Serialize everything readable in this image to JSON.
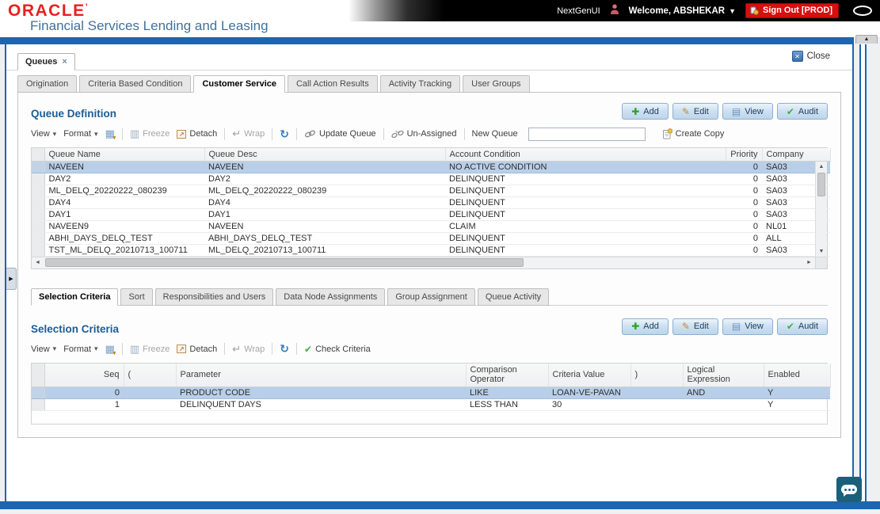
{
  "header": {
    "logo": "ORACLE",
    "logo_mark": "’",
    "subtitle": "Financial Services Lending and Leasing",
    "nextgen_label": "NextGenUI",
    "welcome": "Welcome, ABSHEKAR",
    "sign_out": "Sign Out [PROD]"
  },
  "workspace": {
    "tab_label": "Queues",
    "tab_close": "×",
    "close_label": "Close"
  },
  "main_tabs": {
    "items": [
      "Origination",
      "Criteria Based Condition",
      "Customer Service",
      "Call Action Results",
      "Activity Tracking",
      "User Groups"
    ],
    "active": "Customer Service"
  },
  "actions": {
    "add": "Add",
    "edit": "Edit",
    "view": "View",
    "audit": "Audit"
  },
  "queue_definition": {
    "heading": "Queue Definition",
    "toolbar": {
      "view": "View",
      "format": "Format",
      "freeze": "Freeze",
      "detach": "Detach",
      "wrap": "Wrap",
      "update_queue": "Update Queue",
      "un_assigned": "Un-Assigned",
      "new_queue_label": "New Queue",
      "new_queue_value": "",
      "create_copy": "Create Copy"
    },
    "columns": [
      "Queue Name",
      "Queue Desc",
      "Account Condition",
      "Priority",
      "Company"
    ],
    "rows": [
      {
        "name": "NAVEEN",
        "desc": "NAVEEN",
        "condition": "NO ACTIVE CONDITION",
        "priority": "0",
        "company": "SA03",
        "selected": true
      },
      {
        "name": "DAY2",
        "desc": "DAY2",
        "condition": "DELINQUENT",
        "priority": "0",
        "company": "SA03",
        "selected": false
      },
      {
        "name": "ML_DELQ_20220222_080239",
        "desc": "ML_DELQ_20220222_080239",
        "condition": "DELINQUENT",
        "priority": "0",
        "company": "SA03",
        "selected": false
      },
      {
        "name": "DAY4",
        "desc": "DAY4",
        "condition": "DELINQUENT",
        "priority": "0",
        "company": "SA03",
        "selected": false
      },
      {
        "name": "DAY1",
        "desc": "DAY1",
        "condition": "DELINQUENT",
        "priority": "0",
        "company": "SA03",
        "selected": false
      },
      {
        "name": "NAVEEN9",
        "desc": "NAVEEN",
        "condition": "CLAIM",
        "priority": "0",
        "company": "NL01",
        "selected": false
      },
      {
        "name": "ABHI_DAYS_DELQ_TEST",
        "desc": "ABHI_DAYS_DELQ_TEST",
        "condition": "DELINQUENT",
        "priority": "0",
        "company": "ALL",
        "selected": false
      },
      {
        "name": "TST_ML_DELQ_20210713_100711",
        "desc": "ML_DELQ_20210713_100711",
        "condition": "DELINQUENT",
        "priority": "0",
        "company": "SA03",
        "selected": false
      }
    ]
  },
  "criteria_tabs": {
    "items": [
      "Selection Criteria",
      "Sort",
      "Responsibilities and Users",
      "Data Node Assignments",
      "Group Assignment",
      "Queue Activity"
    ],
    "active": "Selection Criteria"
  },
  "selection_criteria": {
    "heading": "Selection Criteria",
    "toolbar": {
      "view": "View",
      "format": "Format",
      "freeze": "Freeze",
      "detach": "Detach",
      "wrap": "Wrap",
      "check_criteria": "Check Criteria"
    },
    "columns": [
      "Seq",
      "(",
      "Parameter",
      "Comparison Operator",
      "Criteria Value",
      ")",
      "Logical Expression",
      "Enabled"
    ],
    "rows": [
      {
        "seq": "0",
        "open_paren": "",
        "parameter": "PRODUCT CODE",
        "comparison_operator": "LIKE",
        "criteria_value": "LOAN-VE-PAVAN",
        "close_paren": "",
        "logical_expression": "AND",
        "enabled": "Y",
        "selected": true
      },
      {
        "seq": "1",
        "open_paren": "",
        "parameter": "DELINQUENT DAYS",
        "comparison_operator": "LESS THAN",
        "criteria_value": "30",
        "close_paren": "",
        "logical_expression": "",
        "enabled": "Y",
        "selected": false
      }
    ]
  },
  "colors": {
    "accent_blue": "#1e65ac",
    "header_text_blue": "#41719c",
    "oracle_red": "#e8201e",
    "signout_red": "#d60f0f",
    "selected_row": "#b9cfe9",
    "section_heading": "#1a5d96",
    "chat_teal": "#1a607a"
  }
}
